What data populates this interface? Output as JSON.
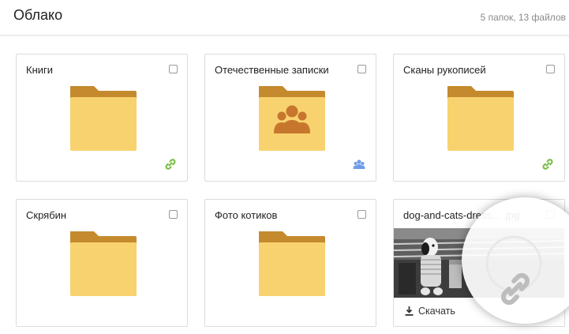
{
  "header": {
    "title": "Облако",
    "count": "5 папок, 13 файлов"
  },
  "items": [
    {
      "name": "Книги",
      "kind": "folder",
      "badge": "link-icon"
    },
    {
      "name": "Отечественные записки",
      "kind": "shared-folder",
      "badge": "shared-users-icon"
    },
    {
      "name": "Сканы рукописей",
      "kind": "folder",
      "badge": "link-icon"
    },
    {
      "name": "Скрябин",
      "kind": "folder",
      "badge": ""
    },
    {
      "name": "Фото котиков",
      "kind": "folder",
      "badge": ""
    },
    {
      "name": "dog-and-cats-dress... .jpg",
      "kind": "image",
      "action": "Скачать",
      "badge": "link-icon"
    }
  ],
  "colors": {
    "folder_body": "#F8D26E",
    "folder_tab": "#C58A2E",
    "link_green": "#7CBF4B",
    "shared_blue": "#6E9BE6"
  }
}
